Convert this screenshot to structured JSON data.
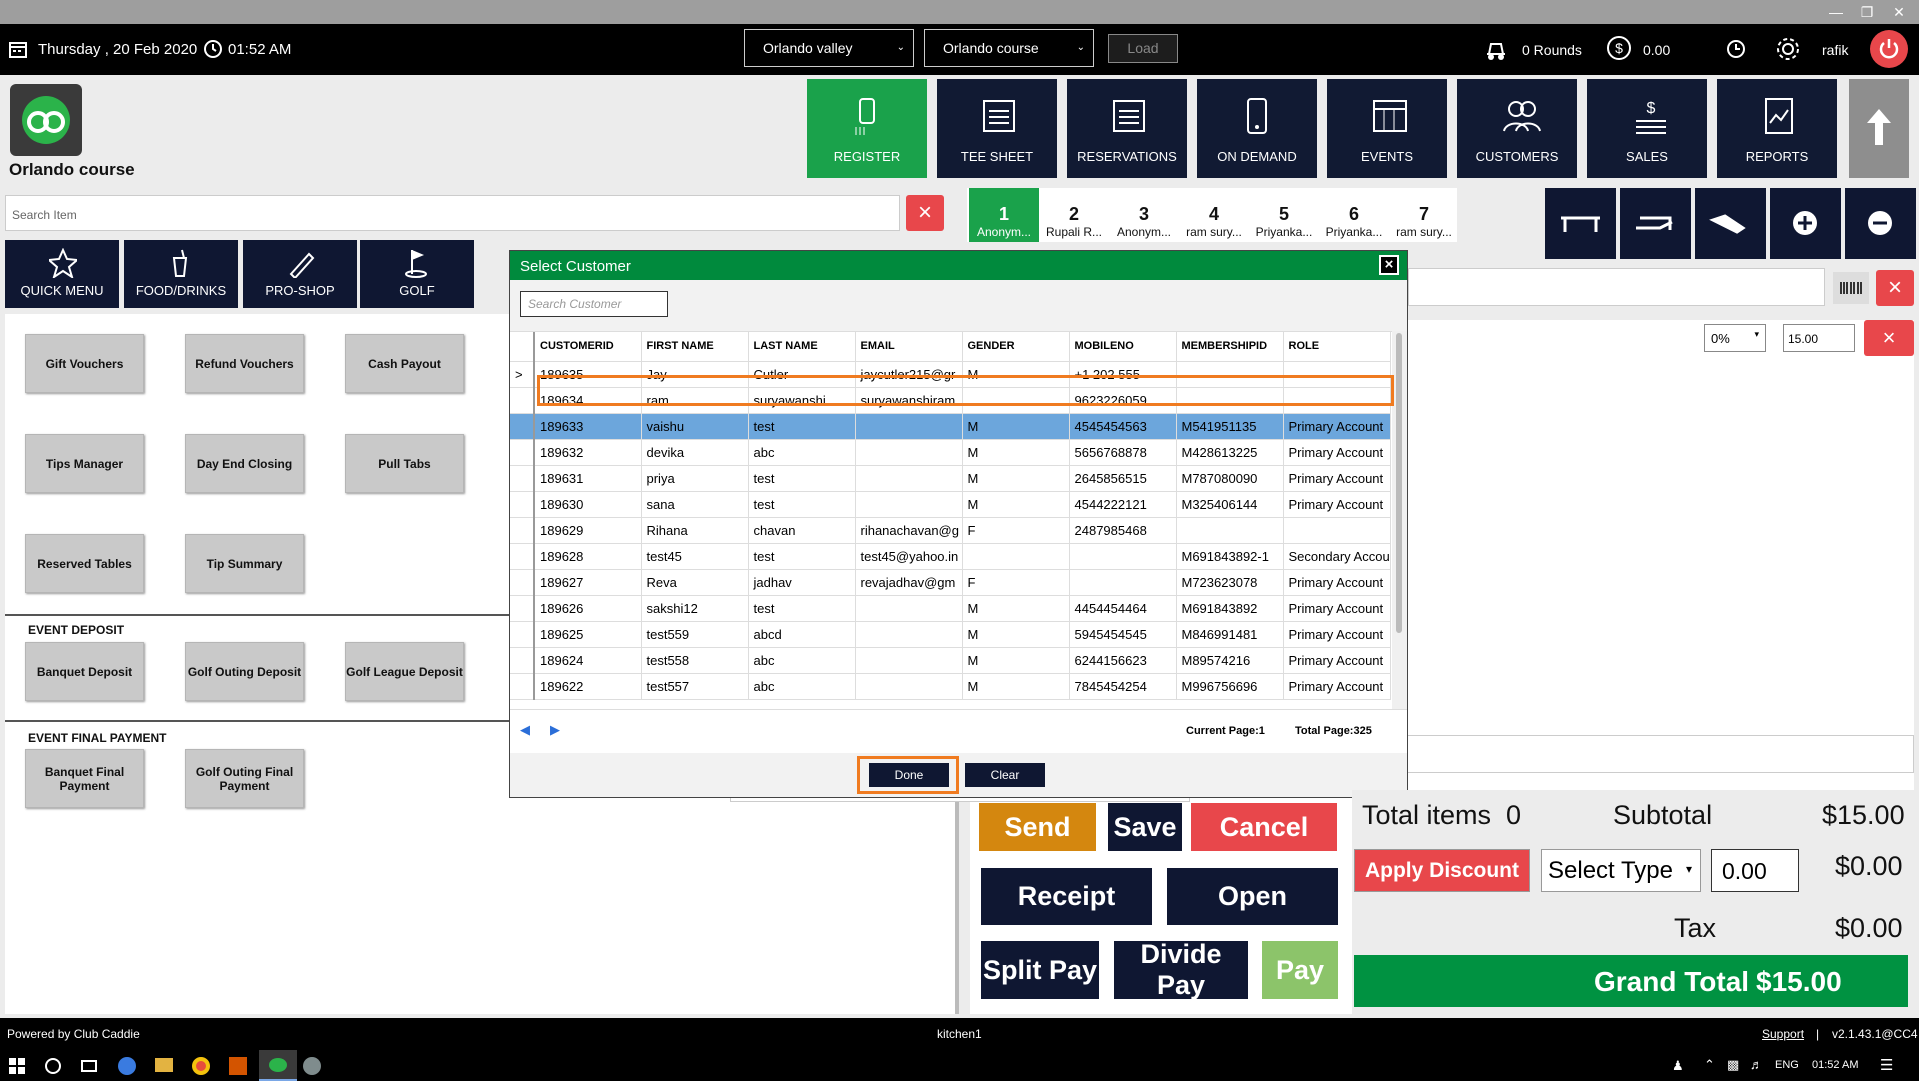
{
  "window": {
    "minimize_icon": "minimize-icon",
    "restore_icon": "restore-icon",
    "close_icon": "close-icon"
  },
  "topbar": {
    "date": "Thursday ,  20 Feb 2020",
    "time": "01:52 AM",
    "location_select": "Orlando valley",
    "course_select": "Orlando course",
    "load_label": "Load",
    "rounds": "0 Rounds",
    "amount": "0.00",
    "user": "rafik"
  },
  "header": {
    "course_name": "Orlando course",
    "nav": [
      {
        "label": "REGISTER"
      },
      {
        "label": "TEE SHEET"
      },
      {
        "label": "RESERVATIONS"
      },
      {
        "label": "ON DEMAND"
      },
      {
        "label": "EVENTS"
      },
      {
        "label": "CUSTOMERS"
      },
      {
        "label": "SALES"
      },
      {
        "label": "REPORTS"
      }
    ]
  },
  "search": {
    "placeholder": "Search Item"
  },
  "categories": [
    {
      "label": "QUICK MENU"
    },
    {
      "label": "FOOD/DRINKS"
    },
    {
      "label": "PRO-SHOP"
    },
    {
      "label": "GOLF"
    }
  ],
  "left_buttons": {
    "row1": [
      "Gift Vouchers",
      "Refund Vouchers",
      "Cash Payout"
    ],
    "row2": [
      "Tips Manager",
      "Day End Closing",
      "Pull Tabs"
    ],
    "row3": [
      "Reserved Tables",
      "Tip Summary"
    ],
    "event_deposit_label": "EVENT DEPOSIT",
    "event_deposit": [
      "Banquet Deposit",
      "Golf Outing Deposit",
      "Golf League Deposit"
    ],
    "event_final_label": "EVENT FINAL PAYMENT",
    "event_final": [
      "Banquet Final Payment",
      "Golf Outing Final Payment"
    ]
  },
  "tabs": [
    {
      "num": "1",
      "name": "Anonym..."
    },
    {
      "num": "2",
      "name": "Rupali R..."
    },
    {
      "num": "3",
      "name": "Anonym..."
    },
    {
      "num": "4",
      "name": "ram sury..."
    },
    {
      "num": "5",
      "name": "Priyanka..."
    },
    {
      "num": "6",
      "name": "Priyanka..."
    },
    {
      "num": "7",
      "name": "ram sury..."
    }
  ],
  "discount": {
    "percent": "0%",
    "value": "15.00"
  },
  "dialog": {
    "title": "Select Customer",
    "search_placeholder": "Search Customer",
    "columns": [
      "CUSTOMERID",
      "FIRST NAME",
      "LAST NAME",
      "EMAIL",
      "GENDER",
      "MOBILENO",
      "MEMBERSHIPID",
      "ROLE"
    ],
    "rows": [
      [
        "189635",
        "Jay",
        "Cutler",
        "jaycutler215@gr",
        "M",
        "+1 202 555",
        "",
        ""
      ],
      [
        "189634",
        "ram",
        "suryawanshi",
        "suryawanshiram",
        "",
        "9623226059",
        "",
        ""
      ],
      [
        "189633",
        "vaishu",
        "test",
        "",
        "M",
        "4545454563",
        "M541951135",
        "Primary Account"
      ],
      [
        "189632",
        "devika",
        "abc",
        "",
        "M",
        "5656768878",
        "M428613225",
        "Primary Account"
      ],
      [
        "189631",
        "priya",
        "test",
        "",
        "M",
        "2645856515",
        "M787080090",
        "Primary Account"
      ],
      [
        "189630",
        "sana",
        "test",
        "",
        "M",
        "4544222121",
        "M325406144",
        "Primary Account"
      ],
      [
        "189629",
        "Rihana",
        "chavan",
        "rihanachavan@g",
        "F",
        "2487985468",
        "",
        ""
      ],
      [
        "189628",
        "test45",
        "test",
        "test45@yahoo.in",
        "",
        "",
        "M691843892-1",
        "Secondary Account"
      ],
      [
        "189627",
        "Reva",
        "jadhav",
        "revajadhav@gm",
        "F",
        "",
        "M723623078",
        "Primary Account"
      ],
      [
        "189626",
        "sakshi12",
        "test",
        "",
        "M",
        "4454454464",
        "M691843892",
        "Primary Account"
      ],
      [
        "189625",
        "test559",
        "abcd",
        "",
        "M",
        "5945454545",
        "M846991481",
        "Primary Account"
      ],
      [
        "189624",
        "test558",
        "abc",
        "",
        "M",
        "6244156623",
        "M89574216",
        "Primary Account"
      ],
      [
        "189622",
        "test557",
        "abc",
        "",
        "M",
        "7845454254",
        "M996756696",
        "Primary Account"
      ]
    ],
    "selected_row_marker": ">",
    "current_page": "Current Page:1",
    "total_page": "Total Page:325",
    "done_label": "Done",
    "clear_label": "Clear"
  },
  "actions": {
    "send": "Send",
    "save": "Save",
    "cancel": "Cancel",
    "receipt": "Receipt",
    "open": "Open",
    "split_pay": "Split Pay",
    "divide_pay": "Divide Pay",
    "pay": "Pay"
  },
  "totals": {
    "total_items_label": "Total items",
    "total_items": "0",
    "subtotal_label": "Subtotal",
    "subtotal": "$15.00",
    "apply_discount": "Apply Discount",
    "select_type": "Select Type",
    "discount_input": "0.00",
    "discount_amount": "$0.00",
    "tax_label": "Tax",
    "tax": "$0.00",
    "grand_total_label": "Grand Total",
    "grand_total": "$15.00"
  },
  "status": {
    "powered_by": "Powered by Club Caddie",
    "station": "kitchen1",
    "support": "Support",
    "version": "v2.1.43.1@CC4"
  },
  "taskbar": {
    "lang": "ENG",
    "time": "01:52 AM"
  },
  "colors": {
    "green": "#008a3d",
    "navy": "#0f1732",
    "red": "#e8474b",
    "orange": "#d4870f"
  }
}
